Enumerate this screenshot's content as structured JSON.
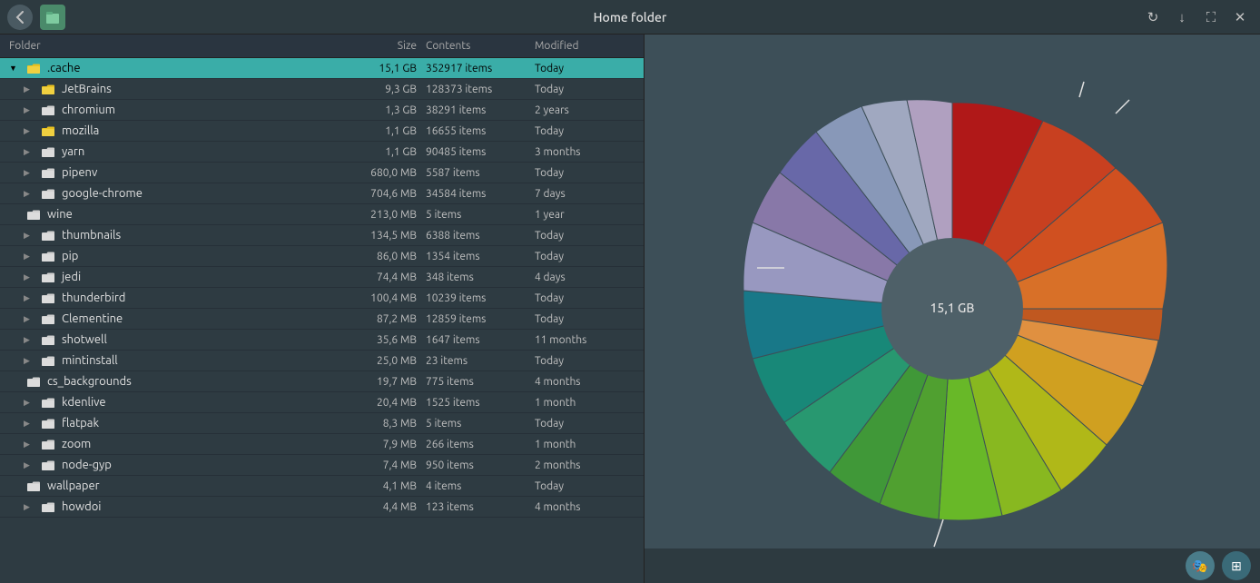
{
  "titlebar": {
    "title": "Home folder",
    "back_label": "←",
    "refresh_label": "↻",
    "download_label": "↓",
    "fullscreen_label": "⛶",
    "close_label": "✕"
  },
  "table": {
    "headers": [
      "Folder",
      "Size",
      "Contents",
      "Modified"
    ],
    "rows": [
      {
        "name": ".cache",
        "size": "15,1 GB",
        "contents": "352917 items",
        "modified": "Today",
        "selected": true,
        "expanded": true,
        "indent": 0,
        "icon_color": "yellow"
      },
      {
        "name": "JetBrains",
        "size": "9,3 GB",
        "contents": "128373 items",
        "modified": "Today",
        "selected": false,
        "expanded": false,
        "indent": 1,
        "icon_color": "yellow"
      },
      {
        "name": "chromium",
        "size": "1,3 GB",
        "contents": "38291 items",
        "modified": "2 years",
        "selected": false,
        "expanded": false,
        "indent": 1,
        "icon_color": "white"
      },
      {
        "name": "mozilla",
        "size": "1,1 GB",
        "contents": "16655 items",
        "modified": "Today",
        "selected": false,
        "expanded": false,
        "indent": 1,
        "icon_color": "yellow"
      },
      {
        "name": "yarn",
        "size": "1,1 GB",
        "contents": "90485 items",
        "modified": "3 months",
        "selected": false,
        "expanded": false,
        "indent": 1,
        "icon_color": "white"
      },
      {
        "name": "pipenv",
        "size": "680,0 MB",
        "contents": "5587 items",
        "modified": "Today",
        "selected": false,
        "expanded": false,
        "indent": 1,
        "icon_color": "white"
      },
      {
        "name": "google-chrome",
        "size": "704,6 MB",
        "contents": "34584 items",
        "modified": "7 days",
        "selected": false,
        "expanded": false,
        "indent": 1,
        "icon_color": "white"
      },
      {
        "name": "wine",
        "size": "213,0 MB",
        "contents": "5 items",
        "modified": "1 year",
        "selected": false,
        "expanded": false,
        "indent": 0,
        "icon_color": "white"
      },
      {
        "name": "thumbnails",
        "size": "134,5 MB",
        "contents": "6388 items",
        "modified": "Today",
        "selected": false,
        "expanded": false,
        "indent": 1,
        "icon_color": "white"
      },
      {
        "name": "pip",
        "size": "86,0 MB",
        "contents": "1354 items",
        "modified": "Today",
        "selected": false,
        "expanded": false,
        "indent": 1,
        "icon_color": "white"
      },
      {
        "name": "jedi",
        "size": "74,4 MB",
        "contents": "348 items",
        "modified": "4 days",
        "selected": false,
        "expanded": false,
        "indent": 1,
        "icon_color": "white"
      },
      {
        "name": "thunderbird",
        "size": "100,4 MB",
        "contents": "10239 items",
        "modified": "Today",
        "selected": false,
        "expanded": false,
        "indent": 1,
        "icon_color": "white"
      },
      {
        "name": "Clementine",
        "size": "87,2 MB",
        "contents": "12859 items",
        "modified": "Today",
        "selected": false,
        "expanded": false,
        "indent": 1,
        "icon_color": "white"
      },
      {
        "name": "shotwell",
        "size": "35,6 MB",
        "contents": "1647 items",
        "modified": "11 months",
        "selected": false,
        "expanded": false,
        "indent": 1,
        "icon_color": "white"
      },
      {
        "name": "mintinstall",
        "size": "25,0 MB",
        "contents": "23 items",
        "modified": "Today",
        "selected": false,
        "expanded": false,
        "indent": 1,
        "icon_color": "white"
      },
      {
        "name": "cs_backgrounds",
        "size": "19,7 MB",
        "contents": "775 items",
        "modified": "4 months",
        "selected": false,
        "expanded": false,
        "indent": 0,
        "icon_color": "white"
      },
      {
        "name": "kdenlive",
        "size": "20,4 MB",
        "contents": "1525 items",
        "modified": "1 month",
        "selected": false,
        "expanded": false,
        "indent": 1,
        "icon_color": "white"
      },
      {
        "name": "flatpak",
        "size": "8,3 MB",
        "contents": "5 items",
        "modified": "Today",
        "selected": false,
        "expanded": false,
        "indent": 1,
        "icon_color": "white"
      },
      {
        "name": "zoom",
        "size": "7,9 MB",
        "contents": "266 items",
        "modified": "1 month",
        "selected": false,
        "expanded": false,
        "indent": 1,
        "icon_color": "white"
      },
      {
        "name": "node-gyp",
        "size": "7,4 MB",
        "contents": "950 items",
        "modified": "2 months",
        "selected": false,
        "expanded": false,
        "indent": 1,
        "icon_color": "white"
      },
      {
        "name": "wallpaper",
        "size": "4,1 MB",
        "contents": "4 items",
        "modified": "Today",
        "selected": false,
        "expanded": false,
        "indent": 0,
        "icon_color": "white"
      },
      {
        "name": "howdoi",
        "size": "4,4 MB",
        "contents": "123 items",
        "modified": "4 months",
        "selected": false,
        "expanded": false,
        "indent": 1,
        "icon_color": "white"
      }
    ]
  },
  "chart": {
    "center_label": "15,1 GB"
  },
  "bottom_bar": {
    "icon1": "🎭",
    "icon2": "⊞"
  }
}
